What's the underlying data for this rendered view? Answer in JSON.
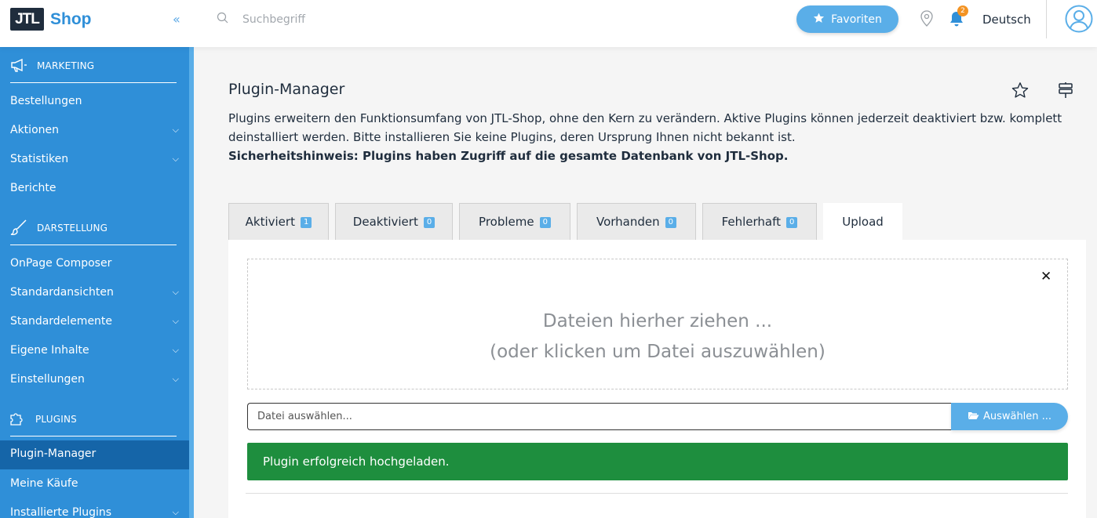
{
  "app": {
    "logo_box": "JTL",
    "logo_text": "Shop",
    "collapse_symbol": "«"
  },
  "header": {
    "search_placeholder": "Suchbegriff",
    "favorites_label": "Favoriten",
    "notification_count": "2",
    "language": "Deutsch"
  },
  "sidebar": {
    "sections": {
      "marketing": "MARKETING",
      "darstellung": "DARSTELLUNG",
      "plugins": "PLUGINS"
    },
    "items": {
      "bestellungen": "Bestellungen",
      "aktionen": "Aktionen",
      "statistiken": "Statistiken",
      "berichte": "Berichte",
      "onpage": "OnPage Composer",
      "standardansichten": "Standardansichten",
      "standardelemente": "Standardelemente",
      "eigene_inhalte": "Eigene Inhalte",
      "einstellungen": "Einstellungen",
      "plugin_manager": "Plugin-Manager",
      "meine_kaeufe": "Meine Käufe",
      "installierte_plugins": "Installierte Plugins"
    },
    "chevron": "⌵"
  },
  "main": {
    "title": "Plugin-Manager",
    "description": "Plugins erweitern den Funktionsumfang von JTL-Shop, ohne den Kern zu verändern. Aktive Plugins können jederzeit deaktiviert bzw. komplett deinstalliert werden. Bitte installieren Sie keine Plugins, deren Ursprung Ihnen nicht bekannt ist.",
    "security_note": "Sicherheitshinweis: Plugins haben Zugriff auf die gesamte Datenbank von JTL-Shop.",
    "tabs": [
      {
        "label": "Aktiviert",
        "count": "1"
      },
      {
        "label": "Deaktiviert",
        "count": "0"
      },
      {
        "label": "Probleme",
        "count": "0"
      },
      {
        "label": "Vorhanden",
        "count": "0"
      },
      {
        "label": "Fehlerhaft",
        "count": "0"
      },
      {
        "label": "Upload"
      }
    ],
    "dropzone": {
      "line1": "Dateien hierher ziehen ...",
      "line2": "(oder klicken um Datei auszuwählen)",
      "close_symbol": "✕"
    },
    "file_input_placeholder": "Datei auswählen...",
    "choose_button": "Auswählen ...",
    "success_message": "Plugin erfolgreich hochgeladen."
  },
  "colors": {
    "sidebar": "#2f8fd8",
    "sidebar_active": "#1565a8",
    "accent": "#5aaee8",
    "success": "#1e8e3e",
    "badge_orange": "#f39323"
  }
}
